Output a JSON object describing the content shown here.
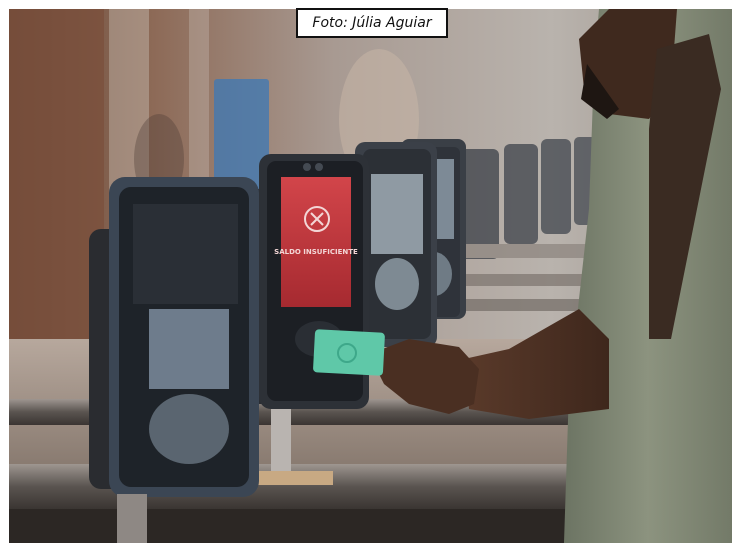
{
  "photo_credit": "Foto: Júlia Aguiar",
  "validator_screen": {
    "status_text": "SALDO INSUFICIENTE"
  },
  "colors": {
    "card": "#5fc8a8",
    "screen_error": "#c8353a",
    "device_body": "#2a2d33"
  }
}
